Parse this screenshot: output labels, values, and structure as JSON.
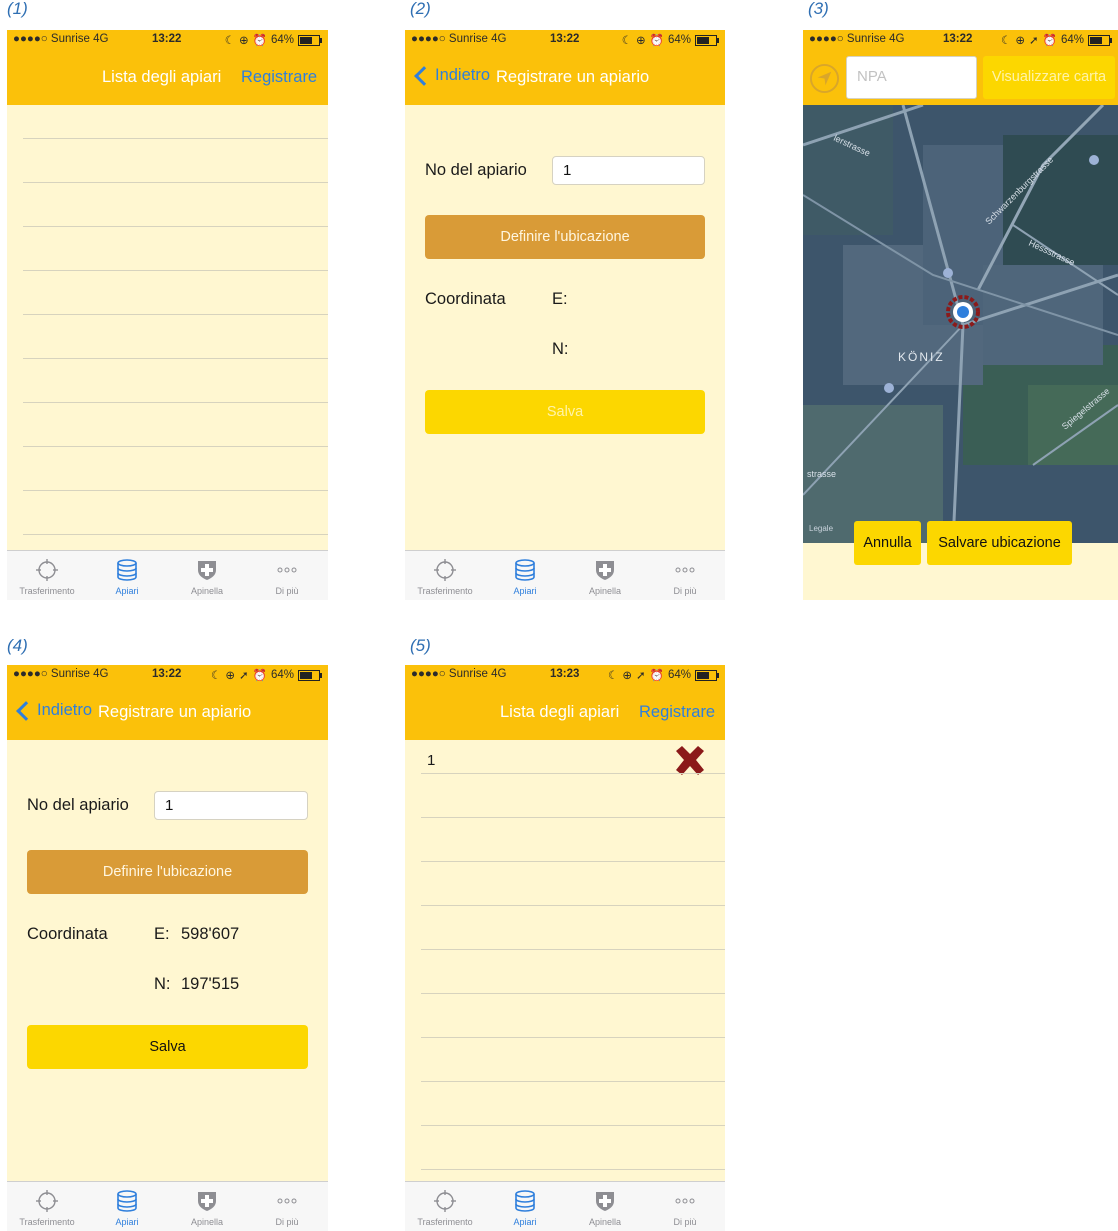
{
  "captions": [
    "(1)",
    "(2)",
    "(3)",
    "(4)",
    "(5)"
  ],
  "status": {
    "carrier": "●●●●○ Sunrise  4G",
    "time_a": "13:22",
    "time_b": "13:23",
    "battery": "64%"
  },
  "list_screen": {
    "title": "Lista degli apiari",
    "register": "Registrare"
  },
  "register_screen": {
    "back": "Indietro",
    "title": "Registrare un apiario",
    "apiary_label": "No del apiario",
    "apiary_value": "1",
    "define_location": "Definire l'ubicazione",
    "coord_label": "Coordinata",
    "e_label": "E:",
    "n_label": "N:",
    "save": "Salva"
  },
  "map_screen": {
    "npa_placeholder": "NPA",
    "show_map": "Visualizzare carta",
    "cancel": "Annulla",
    "save_location": "Salvare ubicazione",
    "streets": [
      "lerstrasse",
      "Schwarzenburgstrasse",
      "Hessstrasse",
      "KÖNIZ",
      "Spiegelstrasse",
      "strasse",
      "Legale"
    ]
  },
  "screen4": {
    "e_value": "598'607",
    "n_value": "197'515"
  },
  "screen5": {
    "list_items": [
      "1"
    ]
  },
  "tabbar": {
    "tabs": [
      "Trasferimento",
      "Apiari",
      "Apinella",
      "Di più"
    ]
  },
  "colors": {
    "nav_yellow": "#fbc10a",
    "background_cream": "#fff7d1",
    "link_blue": "#2f7fdc",
    "button_brown": "#d99b37",
    "button_yellow": "#fcd700",
    "delete_red": "#8b1a1a"
  }
}
